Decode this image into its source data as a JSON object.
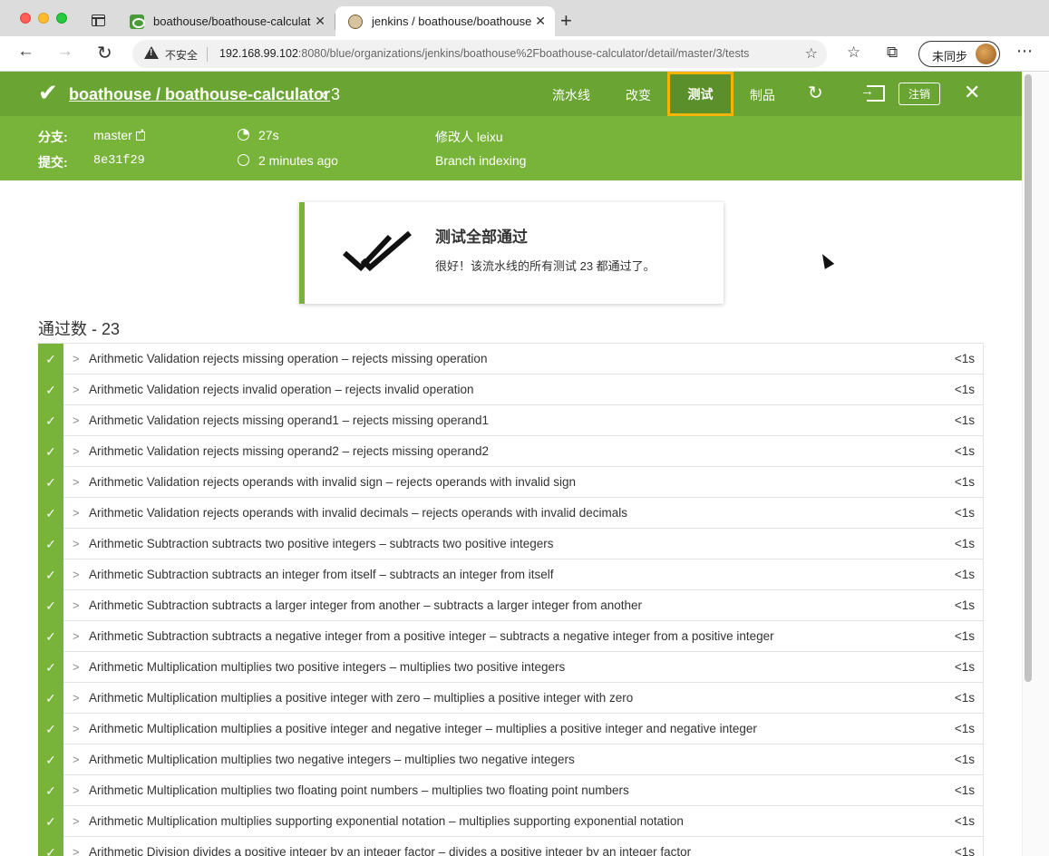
{
  "browser": {
    "tabs": [
      {
        "title": "boathouse/boathouse-calculat",
        "close": "✕"
      },
      {
        "title": "jenkins / boathouse/boathouse",
        "close": "✕"
      }
    ],
    "new_tab": "+",
    "insecure_label": "不安全",
    "url_host": "192.168.99.102",
    "url_rest": ":8080/blue/organizations/jenkins/boathouse%2Fboathouse-calculator/detail/master/3/tests",
    "profile_label": "未同步"
  },
  "header": {
    "title": "boathouse / boathouse-calculator",
    "run_number": "3",
    "nav": {
      "pipeline": "流水线",
      "changes": "改变",
      "tests": "测试",
      "artifacts": "制品"
    },
    "logout": "注销"
  },
  "run_info": {
    "branch_label": "分支:",
    "branch": "master",
    "commit_label": "提交:",
    "commit": "8e31f29",
    "duration": "27s",
    "started": "2 minutes ago",
    "changes_by": "修改人 leixu",
    "cause": "Branch indexing"
  },
  "summary": {
    "title": "测试全部通过",
    "message": "很好！该流水线的所有测试 23 都通过了。"
  },
  "passed": {
    "heading": "通过数 - 23",
    "tests": [
      {
        "name": "Arithmetic Validation rejects missing operation – rejects missing operation",
        "duration": "<1s"
      },
      {
        "name": "Arithmetic Validation rejects invalid operation – rejects invalid operation",
        "duration": "<1s"
      },
      {
        "name": "Arithmetic Validation rejects missing operand1 – rejects missing operand1",
        "duration": "<1s"
      },
      {
        "name": "Arithmetic Validation rejects missing operand2 – rejects missing operand2",
        "duration": "<1s"
      },
      {
        "name": "Arithmetic Validation rejects operands with invalid sign – rejects operands with invalid sign",
        "duration": "<1s"
      },
      {
        "name": "Arithmetic Validation rejects operands with invalid decimals – rejects operands with invalid decimals",
        "duration": "<1s"
      },
      {
        "name": "Arithmetic Subtraction subtracts two positive integers – subtracts two positive integers",
        "duration": "<1s"
      },
      {
        "name": "Arithmetic Subtraction subtracts an integer from itself – subtracts an integer from itself",
        "duration": "<1s"
      },
      {
        "name": "Arithmetic Subtraction subtracts a larger integer from another – subtracts a larger integer from another",
        "duration": "<1s"
      },
      {
        "name": "Arithmetic Subtraction subtracts a negative integer from a positive integer – subtracts a negative integer from a positive integer",
        "duration": "<1s"
      },
      {
        "name": "Arithmetic Multiplication multiplies two positive integers – multiplies two positive integers",
        "duration": "<1s"
      },
      {
        "name": "Arithmetic Multiplication multiplies a positive integer with zero – multiplies a positive integer with zero",
        "duration": "<1s"
      },
      {
        "name": "Arithmetic Multiplication multiplies a positive integer and negative integer – multiplies a positive integer and negative integer",
        "duration": "<1s"
      },
      {
        "name": "Arithmetic Multiplication multiplies two negative integers – multiplies two negative integers",
        "duration": "<1s"
      },
      {
        "name": "Arithmetic Multiplication multiplies two floating point numbers – multiplies two floating point numbers",
        "duration": "<1s"
      },
      {
        "name": "Arithmetic Multiplication multiplies supporting exponential notation – multiplies supporting exponential notation",
        "duration": "<1s"
      },
      {
        "name": "Arithmetic Division divides a positive integer by an integer factor – divides a positive integer by an integer factor",
        "duration": "<1s"
      }
    ]
  },
  "colors": {
    "header_green": "#6aa533",
    "sub_green": "#78b43a",
    "highlight": "#f4b400"
  }
}
